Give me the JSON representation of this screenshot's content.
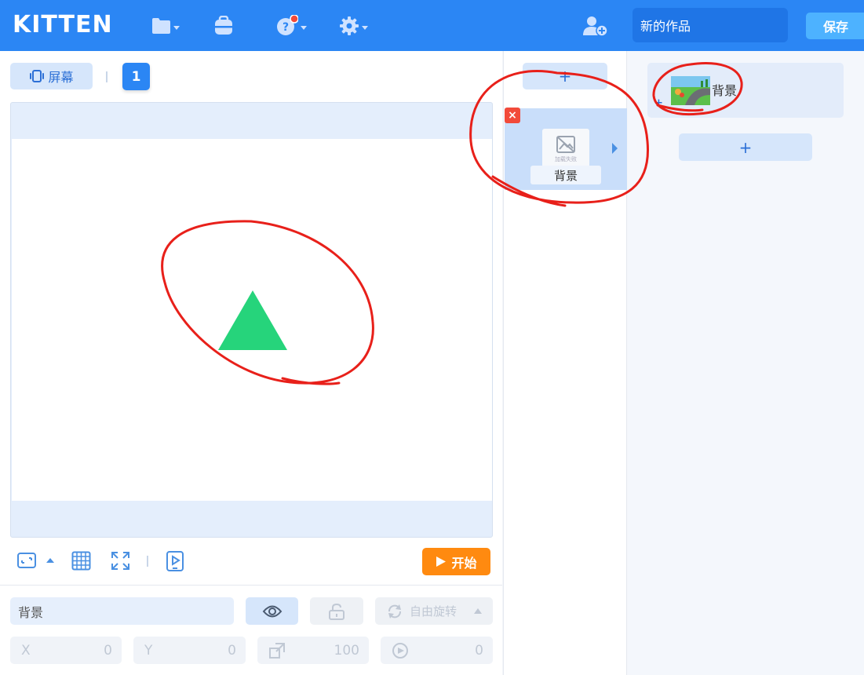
{
  "header": {
    "logo": "KITTEN",
    "project_title": "新的作品",
    "save_label": "保存",
    "colors": {
      "bar": "#2b86f4",
      "save": "#4db2ff",
      "notification_dot": "#f24a3a"
    }
  },
  "stage_toolbar": {
    "screen_label": "屏幕",
    "screen_number": "1"
  },
  "stage": {
    "sprite": "green-triangle-icon",
    "sprite_color": "#26d47b"
  },
  "controls": {
    "start_label": "开始",
    "start_color": "#ff8a10"
  },
  "properties": {
    "name_value": "背景",
    "rotation_label": "自由旋转",
    "x_label": "X",
    "x_value": "0",
    "y_label": "Y",
    "y_value": "0",
    "size_value": "100",
    "direction_value": "0"
  },
  "scene_panel": {
    "add_label": "+",
    "scene": {
      "label": "背景",
      "thumb_text": "加载失败",
      "delete_label": "×"
    }
  },
  "background_panel": {
    "item_name": "背景",
    "item_plus": "+",
    "add_label": "+"
  }
}
